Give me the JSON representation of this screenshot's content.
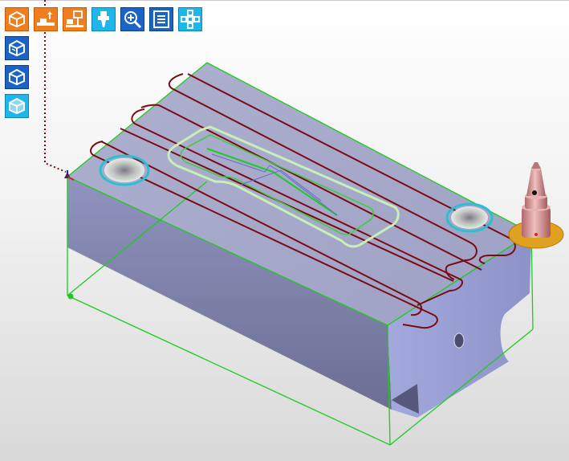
{
  "window": {
    "title": ""
  },
  "toolbar": {
    "top": [
      {
        "name": "view-3d-cube-button",
        "icon": "cube-icon",
        "color": "#f07d1e"
      },
      {
        "name": "machine-setup-button",
        "icon": "machine-table-icon",
        "color": "#f07d1e"
      },
      {
        "name": "fixture-setup-button",
        "icon": "fixture-icon",
        "color": "#f07d1e"
      },
      {
        "name": "tool-button",
        "icon": "spindle-tool-icon",
        "color": "#1fb6ea"
      },
      {
        "name": "zoom-button",
        "icon": "zoom-in-icon",
        "color": "#1b63c4"
      },
      {
        "name": "operations-list-button",
        "icon": "list-icon",
        "color": "#1b63c4"
      },
      {
        "name": "pattern-button",
        "icon": "grid-pattern-icon",
        "color": "#1fb6ea"
      }
    ],
    "left": [
      {
        "name": "stock-view-button",
        "icon": "stock-box-icon",
        "color": "#1b63c4"
      },
      {
        "name": "part-view-button",
        "icon": "part-box-icon",
        "color": "#1b63c4"
      },
      {
        "name": "simulation-view-button",
        "icon": "shaded-box-icon",
        "color": "#1fb6ea"
      }
    ]
  },
  "scene": {
    "part_color": "#9fa2cc",
    "toolpath_color": "#7a0b14",
    "bounding_box_color": "#1ccc1c",
    "contour_color": "#c6f0b6",
    "hole_ring_color": "#2bbfcf",
    "tool_holder_color": "#d08a8a",
    "tool_base_color": "#e0a020"
  }
}
